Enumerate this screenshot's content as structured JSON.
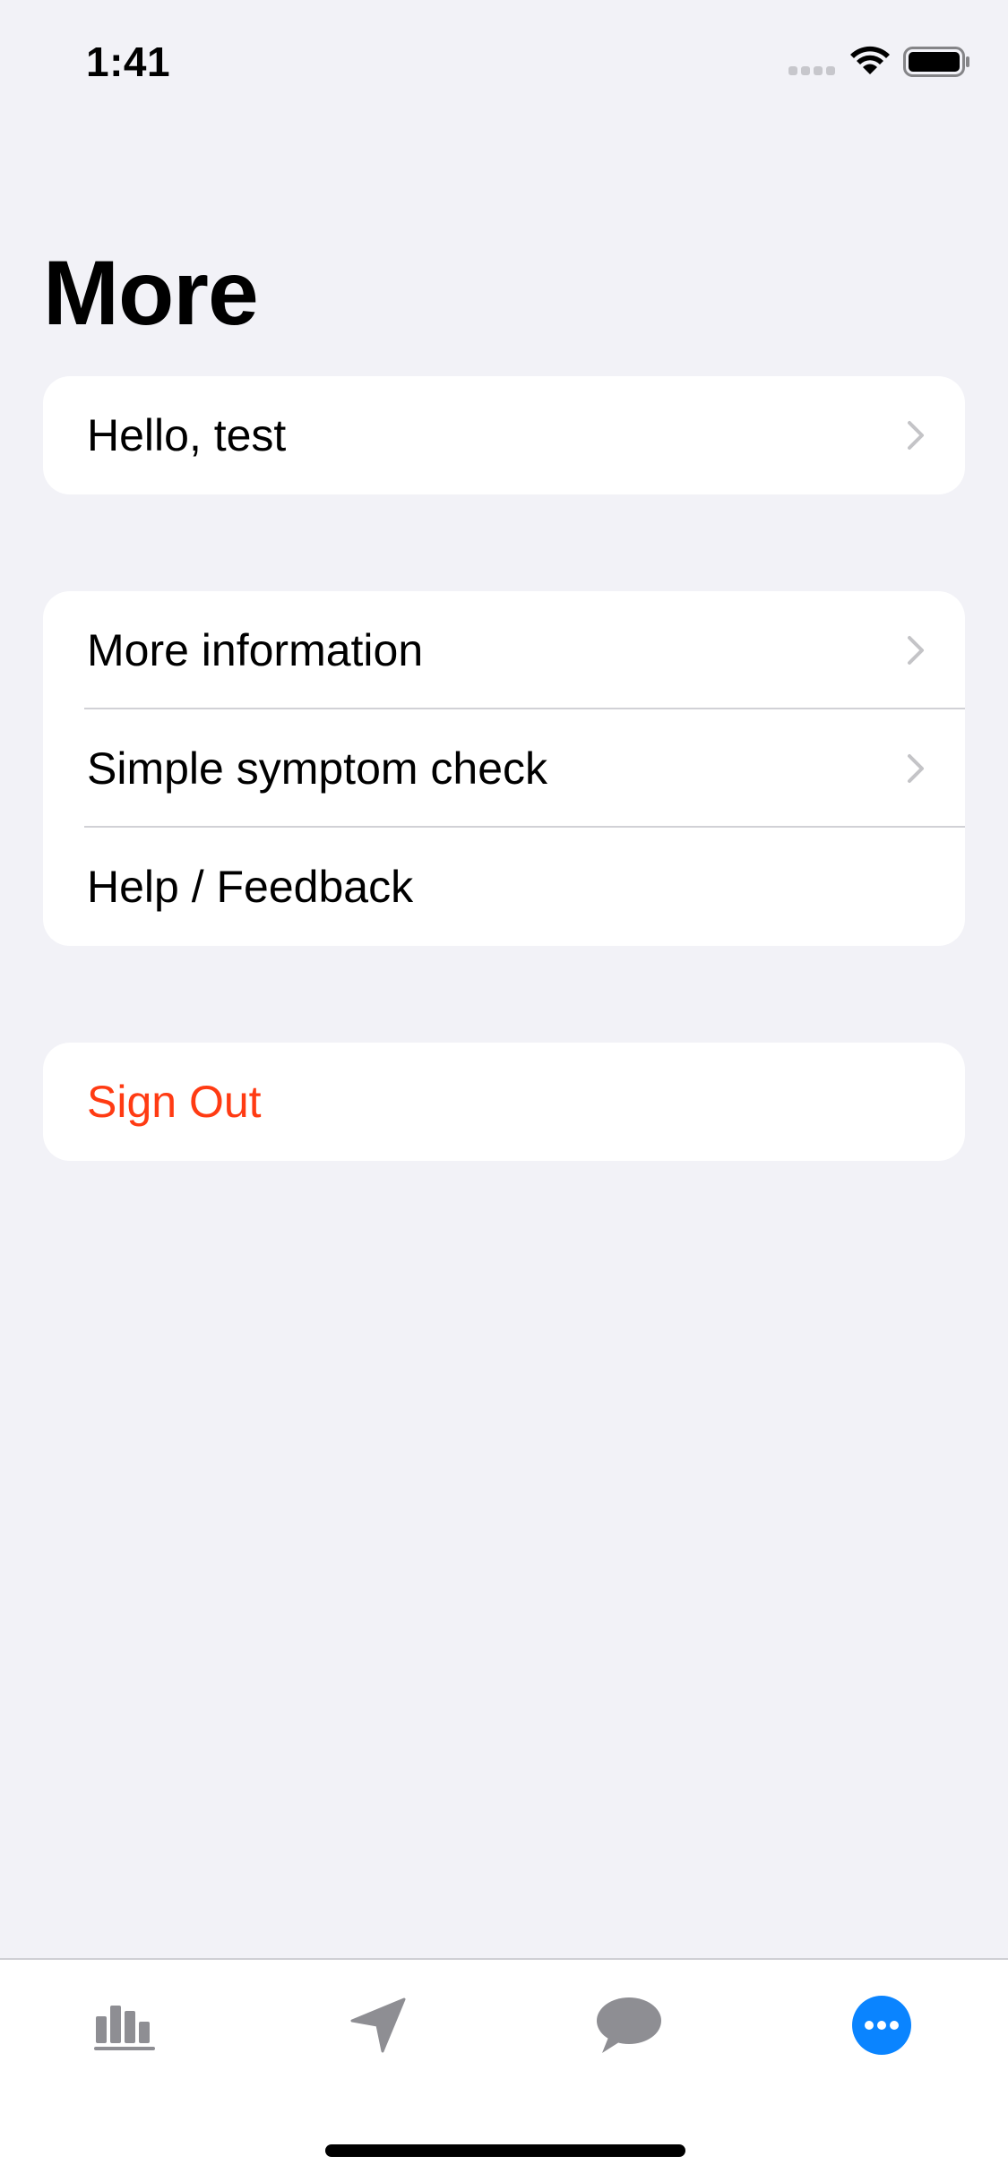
{
  "status_bar": {
    "time": "1:41"
  },
  "page": {
    "title": "More"
  },
  "groups": {
    "profile": {
      "greeting": "Hello, test"
    },
    "info": {
      "more_information": "More information",
      "symptom_check": "Simple symptom check",
      "help_feedback": "Help / Feedback"
    },
    "account": {
      "sign_out": "Sign Out"
    }
  },
  "colors": {
    "background": "#f2f2f7",
    "card": "#ffffff",
    "destructive": "#ff3b13",
    "tab_active": "#0a84ff",
    "tab_inactive": "#8e8e93",
    "chevron": "#c4c4c7"
  },
  "tab_bar": {
    "tabs": [
      {
        "icon": "bar-chart-icon",
        "selected": false
      },
      {
        "icon": "location-arrow-icon",
        "selected": false
      },
      {
        "icon": "speech-bubble-icon",
        "selected": false
      },
      {
        "icon": "more-ellipsis-icon",
        "selected": true
      }
    ]
  }
}
